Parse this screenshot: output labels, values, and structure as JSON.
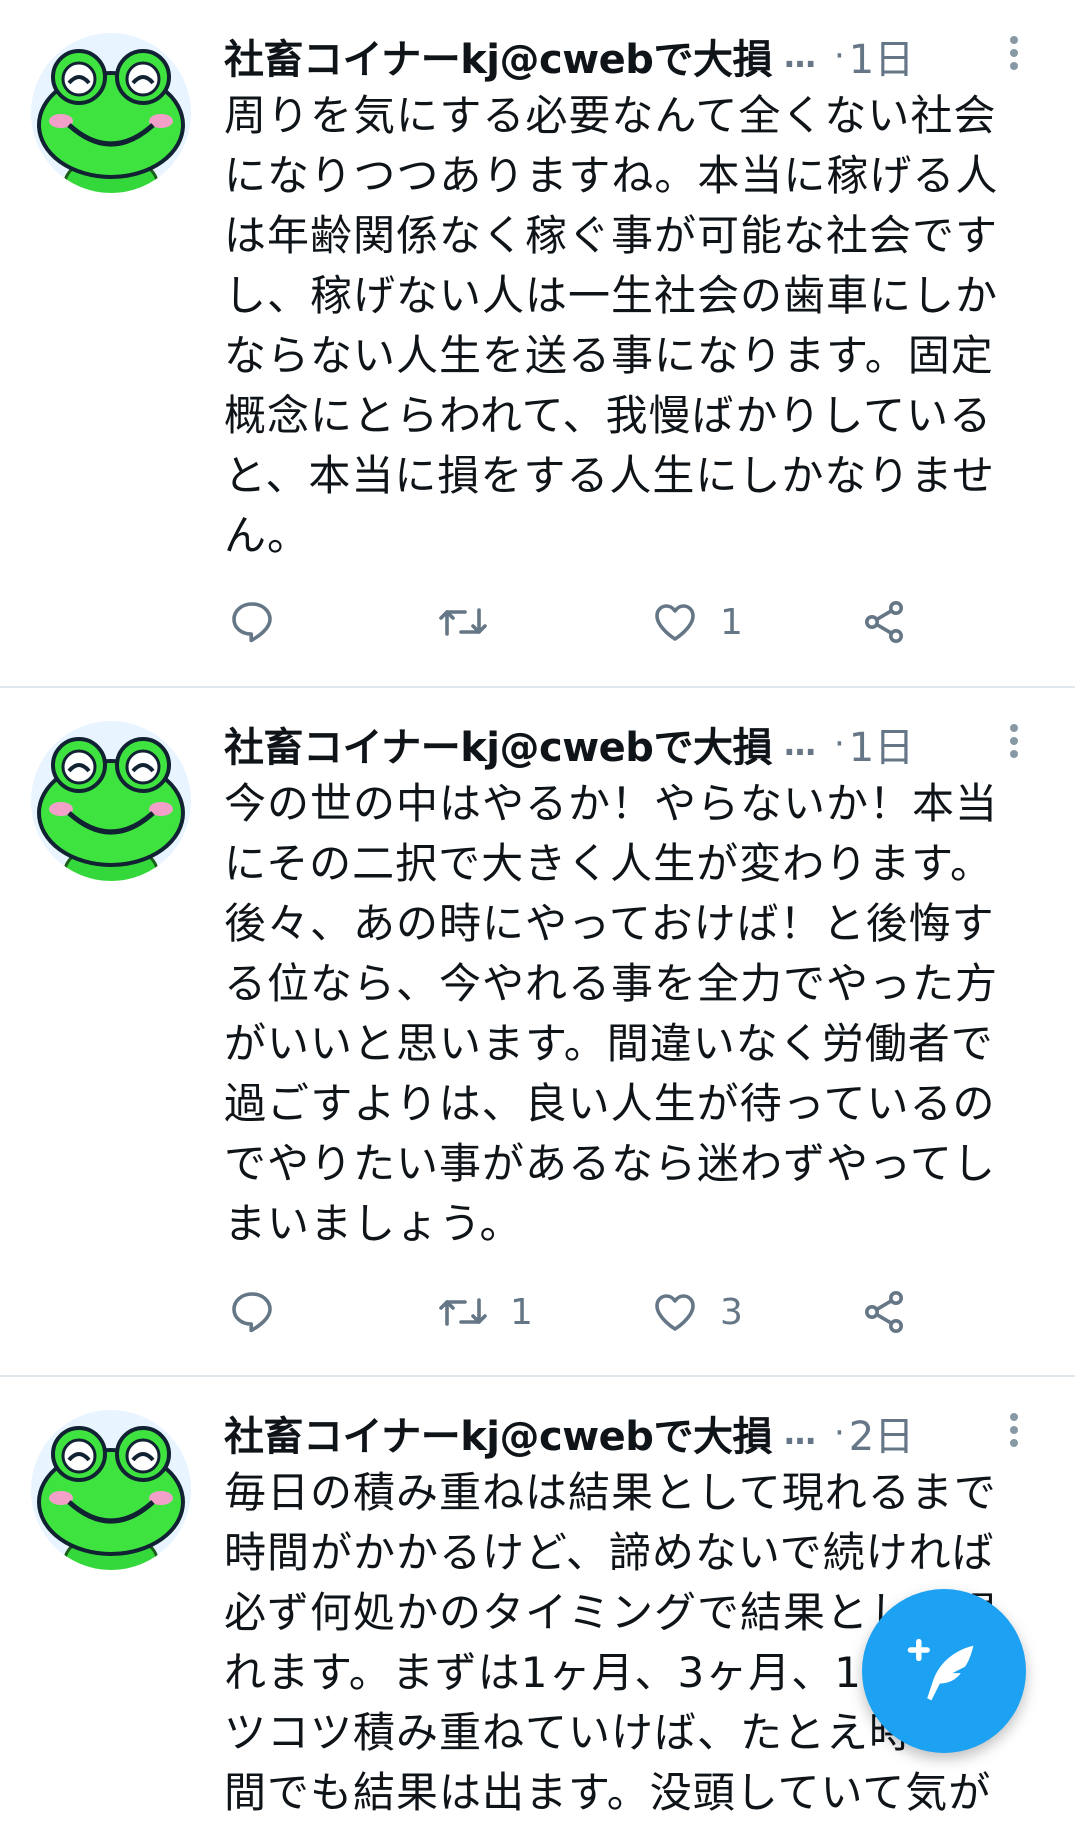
{
  "colors": {
    "accent": "#1da1f2",
    "muted": "#657786",
    "divider": "#e1e8ed"
  },
  "tweets": [
    {
      "author": "社畜コイナーkj@cwebで大損",
      "ellipsis": "…",
      "dot": "·",
      "time": "1日",
      "text": "周りを気にする必要なんて全くない社会\nになりつつありますね。本当に稼げる人\nは年齢関係なく稼ぐ事が可能な社会です\nし、稼げない人は一生社会の歯車にしか\nならない人生を送る事になります。固定\n概念にとらわれて、我慢ばかりしている\nと、本当に損をする人生にしかなりませ\nん。",
      "retweets": "",
      "likes": "1"
    },
    {
      "author": "社畜コイナーkj@cwebで大損",
      "ellipsis": "…",
      "dot": "·",
      "time": "1日",
      "text": "今の世の中はやるか！やらないか！本当\nにその二択で大きく人生が変わります。\n後々、あの時にやっておけば！と後悔す\nる位なら、今やれる事を全力でやった方\nがいいと思います。間違いなく労働者で\n過ごすよりは、良い人生が待っているの\nでやりたい事があるなら迷わずやってし\nまいましょう。",
      "retweets": "1",
      "likes": "3"
    },
    {
      "author": "社畜コイナーkj@cwebで大損",
      "ellipsis": "…",
      "dot": "·",
      "time": "2日",
      "text": "毎日の積み重ねは結果として現れるまで\n時間がかかるけど、諦めないで続ければ\n必ず何処かのタイミングで結果として現\nれます。まずは1ヶ月、3ヶ月、1\nツコツ積み重ねていけば、たとえ時\n間でも結果は出ます。没頭していて気が",
      "retweets": "",
      "likes": ""
    }
  ],
  "icons": {
    "reply": "reply-icon",
    "retweet": "retweet-icon",
    "like": "heart-icon",
    "share": "share-icon",
    "more": "more-vertical-icon",
    "compose": "compose-feather-icon"
  }
}
